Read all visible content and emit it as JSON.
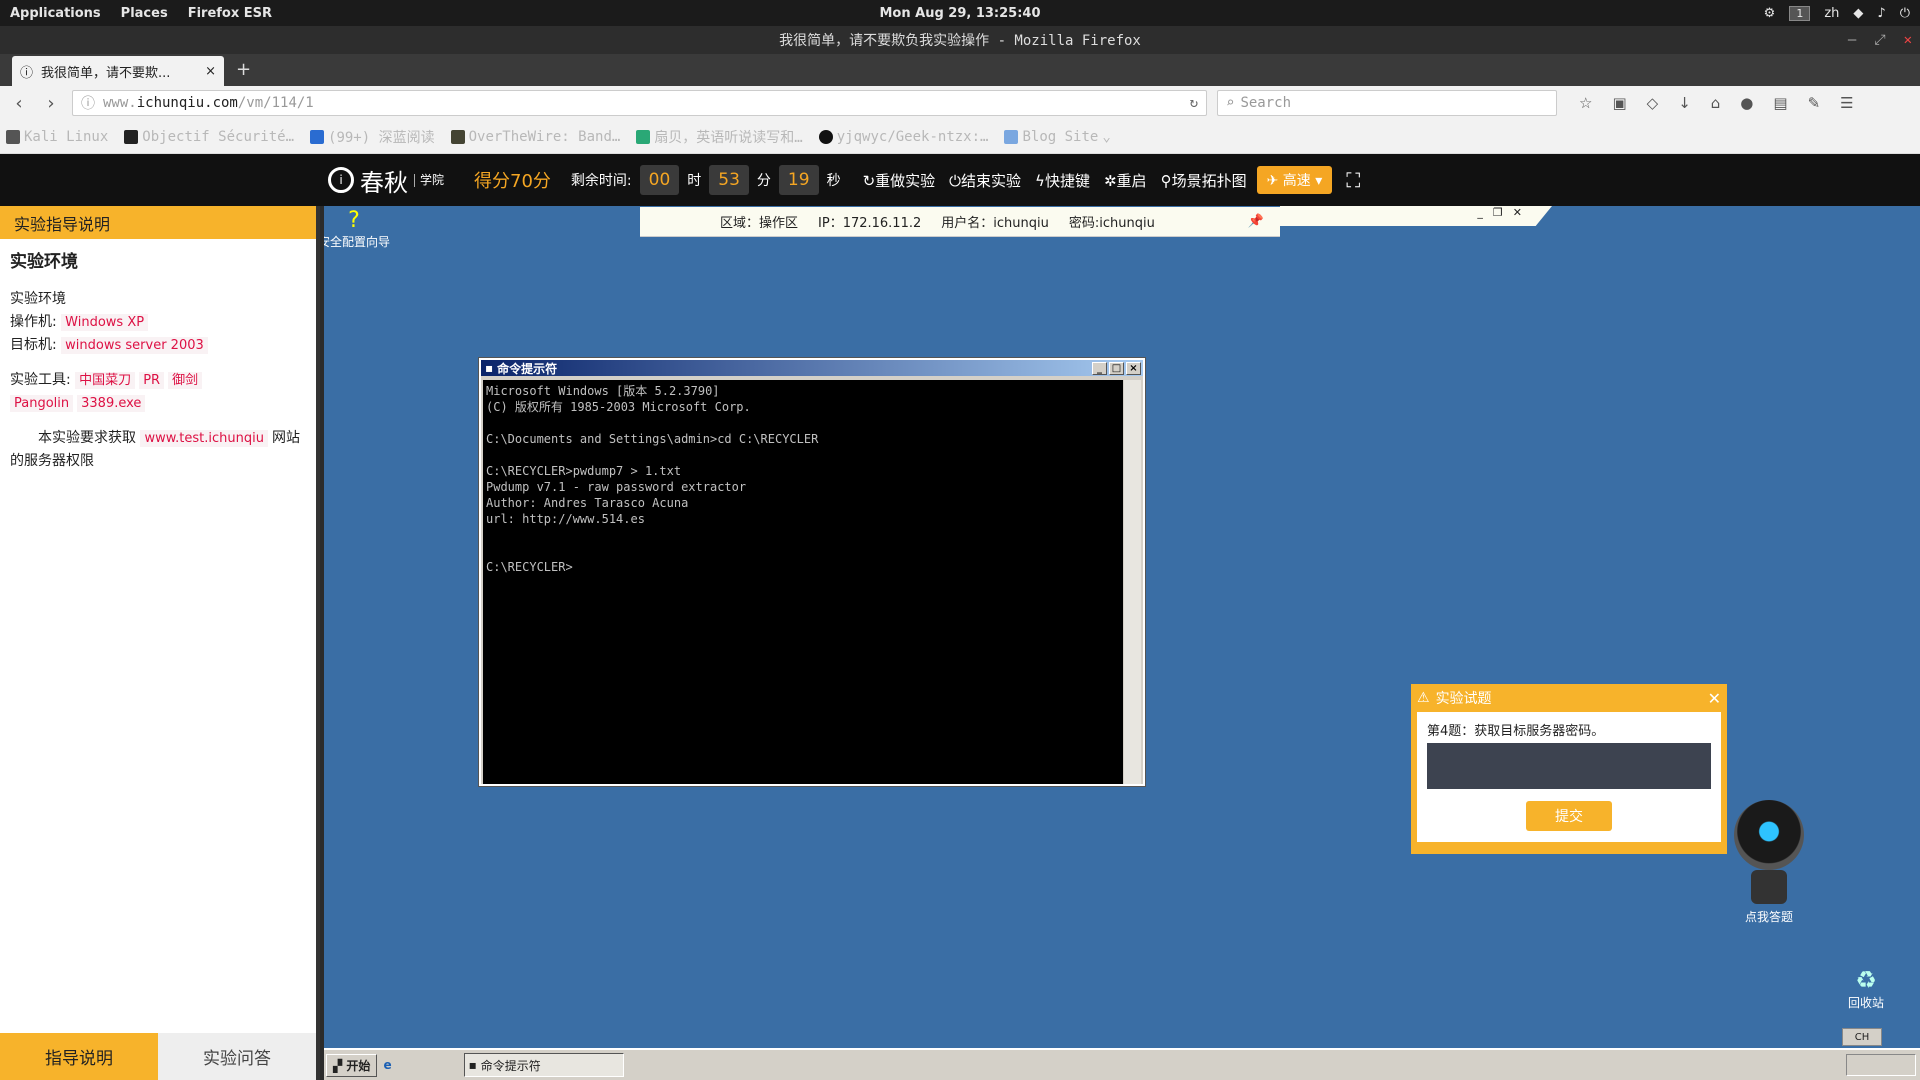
{
  "topbar": {
    "applications": "Applications",
    "places": "Places",
    "firefox": "Firefox ESR",
    "clock": "Mon Aug 29, 13:25:40",
    "workspace": "1",
    "lang": "zh"
  },
  "window": {
    "title": "我很简单，请不要欺负我实验操作 - Mozilla Firefox"
  },
  "tab": {
    "title": "我很简单，请不要欺...",
    "close": "×",
    "new": "+"
  },
  "nav": {
    "url_prefix": "www.",
    "url_domain": "ichunqiu.com",
    "url_path": "/vm/114/1",
    "search_placeholder": "Search"
  },
  "bookmarks": [
    "Kali Linux",
    "Objectif Sécurité…",
    "(99+) 深蓝阅读",
    "OverTheWire: Band…",
    "扇贝，英语听说读写和…",
    "yjqwyc/Geek-ntzx:…",
    "Blog Site"
  ],
  "site": {
    "logo": "春秋",
    "logo_sub": "学院",
    "score": "得分70分",
    "remaining_label": "剩余时间:",
    "hours": "00",
    "h_unit": "时",
    "minutes": "53",
    "m_unit": "分",
    "seconds": "19",
    "s_unit": "秒",
    "actions": [
      "重做实验",
      "结束实验",
      "快捷键",
      "重启",
      "场景拓扑图"
    ],
    "speed": "高速"
  },
  "guide": {
    "header": "实验指导说明",
    "section_title": "实验环境",
    "env_label": "实验环境",
    "os_label": "操作机:",
    "os_value": "Windows XP",
    "target_label": "目标机:",
    "target_value": "windows server 2003",
    "tools_label": "实验工具:",
    "tools": [
      "中国菜刀",
      "PR",
      "御剑",
      "Pangolin",
      "3389.exe"
    ],
    "req_prefix": "本实验要求获取",
    "req_link": "www.test.ichunqiu",
    "req_suffix": "网站的服务器权限",
    "tab_active": "指导说明",
    "tab_inactive": "实验问答"
  },
  "conn": {
    "zone": "区域：操作区",
    "ip": "IP：172.16.11.2",
    "user": "用户名：ichunqiu",
    "pass": "密码:ichunqiu"
  },
  "desktop": {
    "icon1": "安全配置向导",
    "recycle": "回收站",
    "robot": "点我答题"
  },
  "cmd": {
    "title": "命令提示符",
    "output": "Microsoft Windows [版本 5.2.3790]\n(C) 版权所有 1985-2003 Microsoft Corp.\n\nC:\\Documents and Settings\\admin>cd C:\\RECYCLER\n\nC:\\RECYCLER>pwdump7 > 1.txt\nPwdump v7.1 - raw password extractor\nAuthor: Andres Tarasco Acuna\nurl: http://www.514.es\n\n\nC:\\RECYCLER>"
  },
  "quiz": {
    "title": "实验试题",
    "question": "第4题：获取目标服务器密码。",
    "submit": "提交"
  },
  "taskbar": {
    "start": "开始",
    "task": "命令提示符",
    "ime": "CH"
  }
}
